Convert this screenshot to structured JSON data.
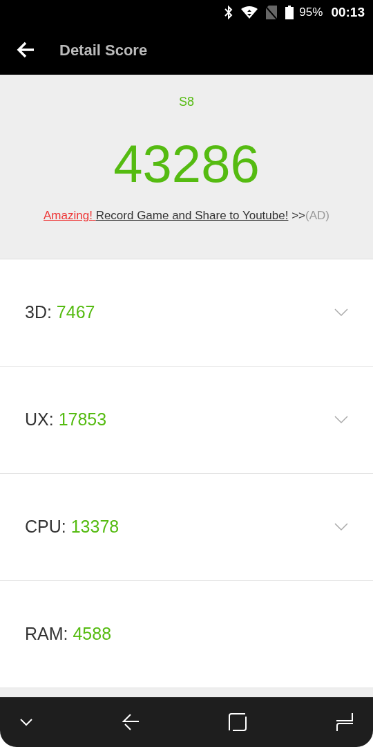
{
  "status_bar": {
    "battery": "95%",
    "time": "00:13"
  },
  "app_bar": {
    "title": "Detail Score"
  },
  "summary": {
    "device": "S8",
    "score": "43286",
    "ad": {
      "highlight": "Amazing!",
      "text": "Record Game and Share to Youtube!",
      "arrows": ">>",
      "tag": "(AD)"
    }
  },
  "scores": [
    {
      "label": "3D:",
      "value": "7467",
      "expandable": true
    },
    {
      "label": "UX:",
      "value": "17853",
      "expandable": true
    },
    {
      "label": "CPU:",
      "value": "13378",
      "expandable": true
    },
    {
      "label": "RAM:",
      "value": "4588",
      "expandable": false
    }
  ]
}
